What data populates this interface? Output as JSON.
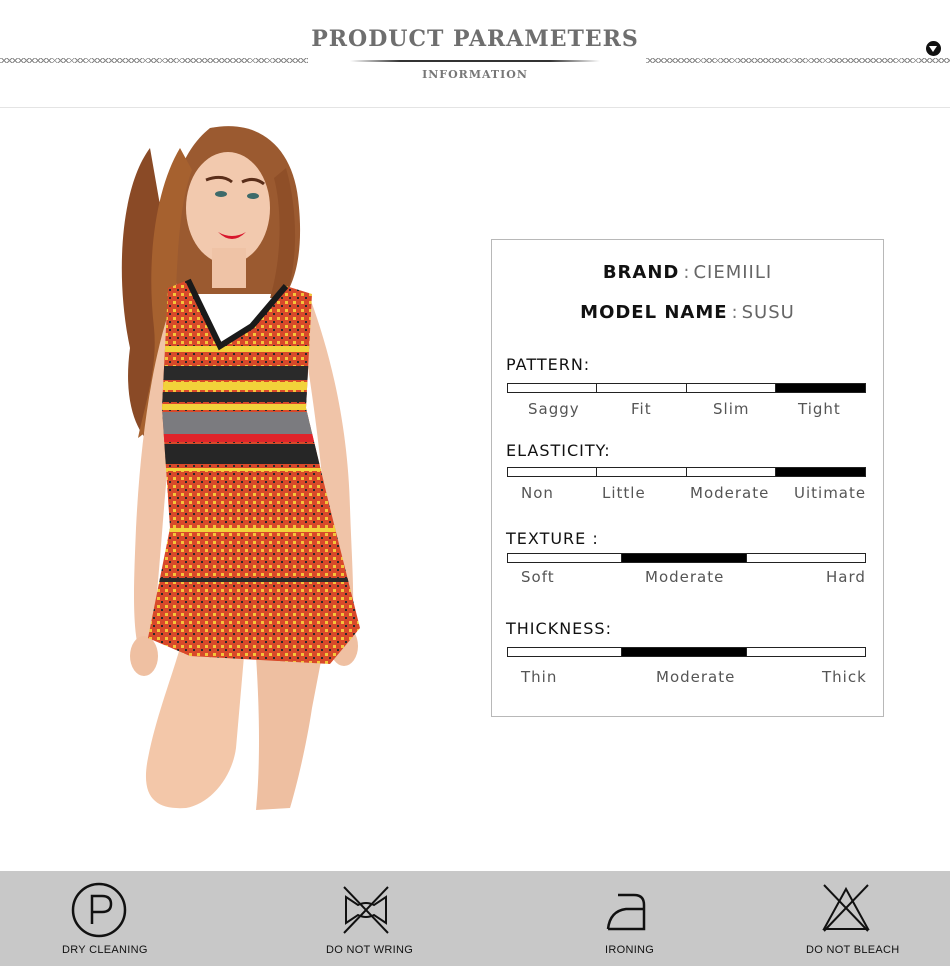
{
  "header": {
    "title": "PRODUCT PARAMETERS",
    "subtitle": "INFORMATION",
    "scroll_icon": "chevron-down-icon"
  },
  "photo": {
    "description_icon": "model-photo"
  },
  "params": {
    "brand": {
      "label": "BRAND",
      "separator": ":",
      "value": "CIEMIILI"
    },
    "model": {
      "label": "MODEL NAME",
      "separator": ":",
      "value": "SUSU"
    },
    "pattern": {
      "label": "PATTERN:",
      "options": [
        "Saggy",
        "Fit",
        "Slim",
        "Tight"
      ],
      "selected": "Tight"
    },
    "elasticity": {
      "label": "ELASTICITY:",
      "options": [
        "Non",
        "Little",
        "Moderate",
        "Uitimate"
      ],
      "selected": "Uitimate"
    },
    "texture": {
      "label": "TEXTURE :",
      "options": [
        "Soft",
        "Moderate",
        "Hard"
      ],
      "selected": "Moderate"
    },
    "thickness": {
      "label": "THICKNESS:",
      "options": [
        "Thin",
        "Moderate",
        "Thick"
      ],
      "selected": "Moderate"
    }
  },
  "care": {
    "items": [
      {
        "label": "DRY CLEANING",
        "icon": "dry-clean-p-icon"
      },
      {
        "label": "DO NOT WRING",
        "icon": "do-not-wring-icon"
      },
      {
        "label": "IRONING",
        "icon": "iron-icon"
      },
      {
        "label": "DO NOT BLEACH",
        "icon": "do-not-bleach-icon"
      }
    ]
  },
  "colors": {
    "footer_bg": "#c8c8c8",
    "indicator": "#000000",
    "dress_red": "#d94a28",
    "dress_yellow": "#f2d23a"
  }
}
